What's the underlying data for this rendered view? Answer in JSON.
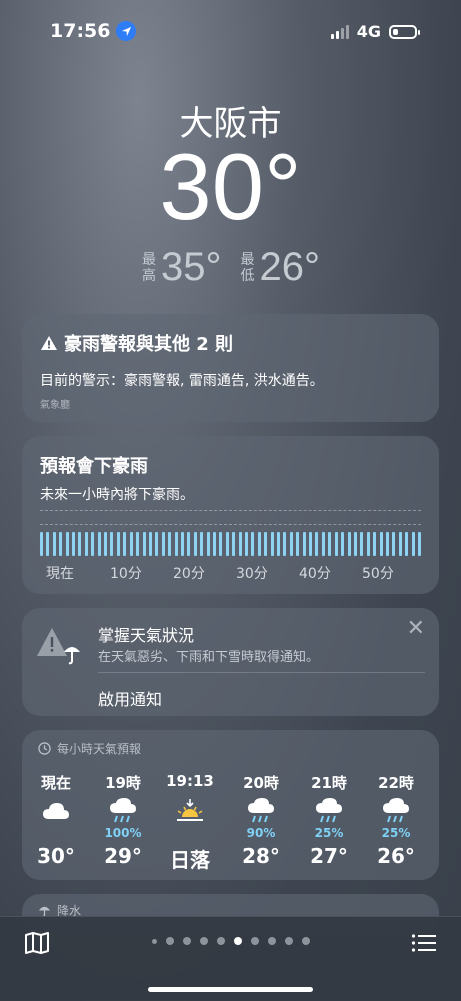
{
  "status_bar": {
    "time": "17:56",
    "network": "4G"
  },
  "location": {
    "city": "大阪市",
    "temperature": "30°",
    "high_label": "最高",
    "high": "35°",
    "low_label": "最低",
    "low": "26°"
  },
  "alert": {
    "title": "豪雨警報與其他 2 則",
    "body": "目前的警示：豪雨警報, 雷雨通告, 洪水通告。",
    "source": "氣象廳"
  },
  "rain_forecast": {
    "title": "預報會下豪雨",
    "subtitle": "未來一小時內將下豪雨。",
    "axis_labels": [
      "現在",
      "10分",
      "20分",
      "30分",
      "40分",
      "50分"
    ],
    "intensity_level": 0.75
  },
  "notification": {
    "title": "掌握天氣狀況",
    "subtitle": "在天氣惡劣、下雨和下雪時取得通知。",
    "action": "啟用通知"
  },
  "hourly": {
    "header": "每小時天氣預報",
    "items": [
      {
        "time": "現在",
        "icon": "cloud-icon",
        "pct": "",
        "temp": "30°"
      },
      {
        "time": "19時",
        "icon": "cloud-rain-icon",
        "pct": "100%",
        "temp": "29°"
      },
      {
        "time": "19:13",
        "icon": "sunset-icon",
        "pct": "",
        "temp": "日落"
      },
      {
        "time": "20時",
        "icon": "cloud-rain-icon",
        "pct": "90%",
        "temp": "28°"
      },
      {
        "time": "21時",
        "icon": "cloud-rain-icon",
        "pct": "25%",
        "temp": "27°"
      },
      {
        "time": "22時",
        "icon": "cloud-rain-icon",
        "pct": "25%",
        "temp": "26°"
      }
    ]
  },
  "precipitation": {
    "header": "降水"
  },
  "bottom_bar": {
    "page_count": 10,
    "active_page": 5
  },
  "colors": {
    "accent_location": "#2f7df6",
    "rain": "#8fd3f2",
    "precip_pct": "#7fd1f5",
    "sun": "#f5c542"
  }
}
